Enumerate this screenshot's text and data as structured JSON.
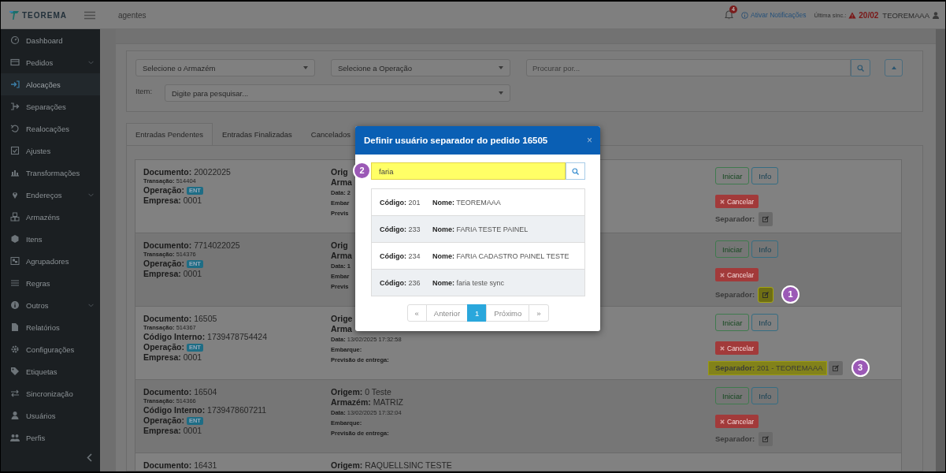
{
  "topbar": {
    "logo": "TEOREMA",
    "page": "agentes",
    "notifications": "4",
    "notify_link": "Ativar Notificações",
    "sync_label": "Última sinc.:",
    "sync_date": "20/02",
    "user": "TEOREMAAA"
  },
  "sidebar": {
    "items": [
      {
        "label": "Dashboard",
        "kind": "gauge",
        "submenu": false,
        "selected": false
      },
      {
        "label": "Pedidos",
        "kind": "card",
        "submenu": true,
        "selected": false
      },
      {
        "label": "Alocações",
        "kind": "enter",
        "submenu": false,
        "selected": true
      },
      {
        "label": "Separações",
        "kind": "exit",
        "submenu": false,
        "selected": false
      },
      {
        "label": "Realocações",
        "kind": "undo",
        "submenu": false,
        "selected": false
      },
      {
        "label": "Ajustes",
        "kind": "check",
        "submenu": false,
        "selected": false
      },
      {
        "label": "Transformações",
        "kind": "chart",
        "submenu": false,
        "selected": false
      },
      {
        "label": "Endereços",
        "kind": "pin",
        "submenu": true,
        "selected": false
      },
      {
        "label": "Armazéns",
        "kind": "cubes",
        "submenu": false,
        "selected": false
      },
      {
        "label": "Itens",
        "kind": "cube",
        "submenu": false,
        "selected": false
      },
      {
        "label": "Agrupadores",
        "kind": "group",
        "submenu": false,
        "selected": false
      },
      {
        "label": "Regras",
        "kind": "list",
        "submenu": false,
        "selected": false
      },
      {
        "label": "Outros",
        "kind": "info",
        "submenu": true,
        "selected": false
      },
      {
        "label": "Relatórios",
        "kind": "file",
        "submenu": false,
        "selected": false
      },
      {
        "label": "Configurações",
        "kind": "gear",
        "submenu": false,
        "selected": false
      },
      {
        "label": "Etiquetas",
        "kind": "tag",
        "submenu": false,
        "selected": false
      },
      {
        "label": "Sincronização",
        "kind": "swap",
        "submenu": false,
        "selected": false
      },
      {
        "label": "Usuários",
        "kind": "user",
        "submenu": false,
        "selected": false
      },
      {
        "label": "Perfis",
        "kind": "users",
        "submenu": false,
        "selected": false
      }
    ]
  },
  "filters": {
    "warehouse_placeholder": "Selecione o Armazém",
    "operation_placeholder": "Selecione a Operação",
    "search_placeholder": "Procurar por...",
    "item_label": "Item:",
    "item_placeholder": "Digite para pesquisar..."
  },
  "tabs": [
    {
      "label": "Entradas Pendentes",
      "selected": true
    },
    {
      "label": "Entradas Finalizadas",
      "selected": false
    },
    {
      "label": "Cancelados",
      "selected": false
    }
  ],
  "entries": [
    {
      "left": [
        {
          "kind": "field",
          "label": "Documento:",
          "value": "20022025"
        },
        {
          "kind": "small",
          "label": "Transação:",
          "value": "514404"
        },
        {
          "kind": "badge",
          "label": "Operação:",
          "value": "ENT"
        },
        {
          "kind": "field",
          "label": "Empresa:",
          "value": "0001"
        }
      ],
      "middle": [
        {
          "kind": "field",
          "label": "Orig"
        },
        {
          "kind": "field",
          "label": "Arma"
        },
        {
          "kind": "small",
          "label": "Data: 2"
        },
        {
          "kind": "small",
          "label": "Embar"
        },
        {
          "kind": "small",
          "label": "Previs"
        }
      ],
      "actions": {
        "start": "Iniciar",
        "info": "Info",
        "cancel": "Cancelar"
      },
      "separator": {
        "label": "Separador:",
        "highlighted": false
      },
      "edit": {
        "highlighted": false
      }
    },
    {
      "left": [
        {
          "kind": "field",
          "label": "Documento:",
          "value": "7714022025"
        },
        {
          "kind": "small",
          "label": "Transação:",
          "value": "514376"
        },
        {
          "kind": "badge",
          "label": "Operação:",
          "value": "ENT"
        },
        {
          "kind": "field",
          "label": "Empresa:",
          "value": "0001"
        }
      ],
      "middle": [
        {
          "kind": "field",
          "label": "Orig"
        },
        {
          "kind": "field",
          "label": "Arma"
        },
        {
          "kind": "small",
          "label": "Data: 1"
        },
        {
          "kind": "small",
          "label": "Embar"
        },
        {
          "kind": "small",
          "label": "Previs"
        }
      ],
      "actions": {
        "start": "Iniciar",
        "info": "Info",
        "cancel": "Cancelar"
      },
      "separator": {
        "label": "Separador:",
        "highlighted": false
      },
      "edit": {
        "highlighted": true,
        "callout": "1"
      }
    },
    {
      "left": [
        {
          "kind": "field",
          "label": "Documento:",
          "value": "16505"
        },
        {
          "kind": "small",
          "label": "Transação:",
          "value": "514367"
        },
        {
          "kind": "field",
          "label": "Código Interno:",
          "value": "1739478754424"
        },
        {
          "kind": "badge",
          "label": "Operação:",
          "value": "ENT"
        },
        {
          "kind": "field",
          "label": "Empresa:",
          "value": "0001"
        }
      ],
      "middle": [
        {
          "kind": "field",
          "label": "Orige"
        },
        {
          "kind": "field",
          "label": "Arma"
        },
        {
          "kind": "small",
          "label": "Data:",
          "value": "13/02/2025 17:32:58"
        },
        {
          "kind": "small",
          "label": "Embarque:"
        },
        {
          "kind": "small",
          "label": "Previsão de entrega:"
        }
      ],
      "actions": {
        "start": "Iniciar",
        "info": "Info",
        "cancel": "Cancelar"
      },
      "separator": {
        "label": "Separador:",
        "value": "201 - TEOREMAAA",
        "highlighted": true
      },
      "edit": {
        "highlighted": false,
        "callout": "3"
      }
    },
    {
      "left": [
        {
          "kind": "field",
          "label": "Documento:",
          "value": "16504"
        },
        {
          "kind": "small",
          "label": "Transação:",
          "value": "514366"
        },
        {
          "kind": "field",
          "label": "Código Interno:",
          "value": "1739478607211"
        },
        {
          "kind": "badge",
          "label": "Operação:",
          "value": "ENT"
        },
        {
          "kind": "field",
          "label": "Empresa:",
          "value": "0001"
        }
      ],
      "middle": [
        {
          "kind": "field",
          "label": "Origem:",
          "value": "0 Teste"
        },
        {
          "kind": "field",
          "label": "Armazém:",
          "value": "MATRIZ"
        },
        {
          "kind": "small",
          "label": "Data:",
          "value": "13/02/2025 17:32:04"
        },
        {
          "kind": "small",
          "label": "Embarque:"
        },
        {
          "kind": "small",
          "label": "Previsão de entrega:"
        }
      ],
      "actions": {
        "start": "Iniciar",
        "info": "Info",
        "cancel": "Cancelar"
      },
      "separator": {
        "label": "Separador:",
        "highlighted": false
      },
      "edit": {
        "highlighted": false
      }
    },
    {
      "left": [
        {
          "kind": "field",
          "label": "Documento:",
          "value": "16431"
        }
      ],
      "middle": [
        {
          "kind": "field",
          "label": "Origem:",
          "value": "RAQUELLSINC TESTE"
        }
      ]
    }
  ],
  "modal": {
    "title": "Definir usuário separador do pedido 16505",
    "close": "×",
    "search_value": "faria",
    "search_highlighted": true,
    "search_callout": "2",
    "results": [
      {
        "code_label": "Código:",
        "code": "201",
        "name_label": "Nome:",
        "name": "TEOREMAAA"
      },
      {
        "code_label": "Código:",
        "code": "233",
        "name_label": "Nome:",
        "name": "FARIA TESTE PAINEL"
      },
      {
        "code_label": "Código:",
        "code": "234",
        "name_label": "Nome:",
        "name": "FARIA CADASTRO PAINEL TESTE"
      },
      {
        "code_label": "Código:",
        "code": "236",
        "name_label": "Nome:",
        "name": "faria teste sync"
      }
    ],
    "pagination": [
      {
        "label": "«",
        "selected": false
      },
      {
        "label": "Anterior",
        "selected": false
      },
      {
        "label": "1",
        "selected": true
      },
      {
        "label": "Próximo",
        "selected": false
      },
      {
        "label": "»",
        "selected": false
      }
    ]
  }
}
